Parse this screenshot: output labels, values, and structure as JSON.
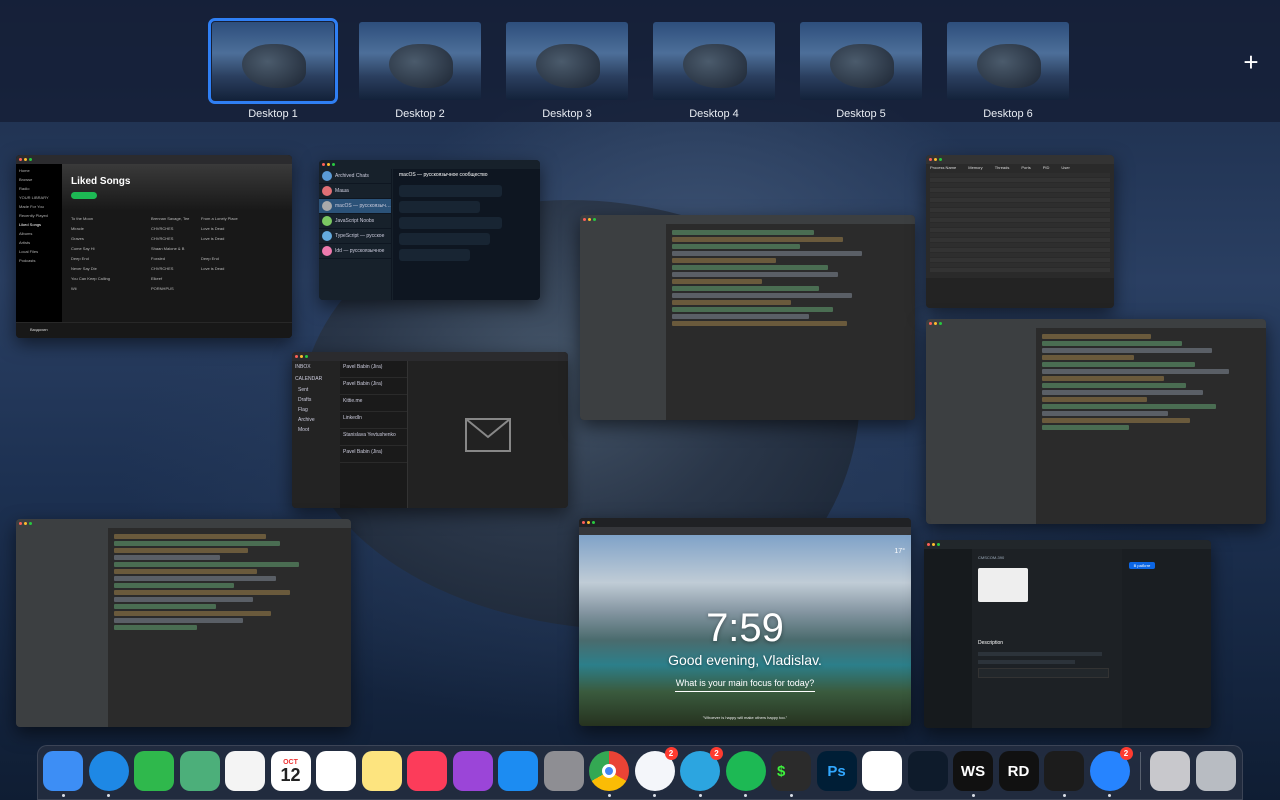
{
  "spaces": {
    "desktops": [
      {
        "label": "Desktop 1",
        "active": true
      },
      {
        "label": "Desktop 2",
        "active": false
      },
      {
        "label": "Desktop 3",
        "active": false
      },
      {
        "label": "Desktop 4",
        "active": false
      },
      {
        "label": "Desktop 5",
        "active": false
      },
      {
        "label": "Desktop 6",
        "active": false
      }
    ],
    "add_label": "+"
  },
  "windows": {
    "spotify": {
      "title": "Liked Songs",
      "sidebar": [
        "Home",
        "Browse",
        "Radio",
        "YOUR LIBRARY",
        "Made For You",
        "Recently Played",
        "Liked Songs",
        "Albums",
        "Artists",
        "Local Files",
        "Podcasts"
      ],
      "tracks": [
        {
          "title": "To the Moon",
          "artist": "Brennan Savage, Tee",
          "album": "From a Lonely Place"
        },
        {
          "title": "Miracle",
          "artist": "CHVRCHES",
          "album": "Love is Dead"
        },
        {
          "title": "Graves",
          "artist": "CHVRCHES",
          "album": "Love is Dead"
        },
        {
          "title": "Come Say Hi",
          "artist": "Shaan Malone & B",
          "album": ""
        },
        {
          "title": "Deep End",
          "artist": "Foxsled",
          "album": "Deep End"
        },
        {
          "title": "Never Say Die",
          "artist": "CHVRCHES",
          "album": "Love is Dead"
        },
        {
          "title": "You Can Keep Calling",
          "artist": "Elkeef",
          "album": ""
        },
        {
          "title": "Wii",
          "artist": "PORNHPUS",
          "album": ""
        }
      ],
      "user": "Ваздохин"
    },
    "telegram": {
      "chats": [
        "Archived Chats",
        "Маша",
        "macOS — русскоязыч…",
        "JavaScript Noobs",
        "TypeScript — русское",
        "Idd — русскоязычное"
      ],
      "header": "macOS — русскоязычное сообщество"
    },
    "mail": {
      "accounts": [
        "INBOX",
        "CALENDAR"
      ],
      "folders": [
        "Sent",
        "Drafts",
        "Flag",
        "Archive",
        "Moot"
      ],
      "messages": [
        "Pavel Babin (Jira)",
        "Pavel Babin (Jira)",
        "Kittie.me",
        "LinkedIn",
        "Stanislava Yevtushenko",
        "Pavel Babin (Jira)"
      ]
    },
    "activity_monitor": {
      "columns": [
        "Process Name",
        "Memory",
        "Threads",
        "Ports",
        "PID",
        "User"
      ]
    },
    "momentum": {
      "time": "7:59",
      "greeting": "Good evening, Vladislav.",
      "focus_prompt": "What is your main focus for today?",
      "quote": "\"Whoever is happy will make others happy too.\"",
      "temperature": "17°"
    },
    "jira": {
      "ticket": "CMSCOM-390",
      "status_button": "В работе",
      "section": "Description"
    }
  },
  "dock": {
    "apps": [
      {
        "name": "Finder",
        "icon": "finder-icon",
        "color": "#3d8ef5",
        "running": true
      },
      {
        "name": "Safari",
        "icon": "safari-icon",
        "color": "#1e88e5",
        "running": true
      },
      {
        "name": "FaceTime",
        "icon": "facetime-icon",
        "color": "#2fb84c",
        "running": false
      },
      {
        "name": "Maps",
        "icon": "maps-icon",
        "color": "#4caf7a",
        "running": false
      },
      {
        "name": "Photos",
        "icon": "photos-icon",
        "color": "#f4f4f4",
        "running": false
      },
      {
        "name": "Calendar",
        "icon": "calendar-icon",
        "color": "#ffffff",
        "running": false,
        "label": "12",
        "month": "OCT"
      },
      {
        "name": "Reminders",
        "icon": "reminders-icon",
        "color": "#ffffff",
        "running": false
      },
      {
        "name": "Notes",
        "icon": "notes-icon",
        "color": "#fde47f",
        "running": false
      },
      {
        "name": "Music",
        "icon": "music-icon",
        "color": "#fc3c5a",
        "running": false
      },
      {
        "name": "Podcasts",
        "icon": "podcasts-icon",
        "color": "#9b45d8",
        "running": false
      },
      {
        "name": "App Store",
        "icon": "appstore-icon",
        "color": "#1c8cf2",
        "running": false
      },
      {
        "name": "System Preferences",
        "icon": "settings-icon",
        "color": "#8e8e93",
        "running": false
      },
      {
        "name": "Chrome",
        "icon": "chrome-icon",
        "color": "#ffffff",
        "running": true
      },
      {
        "name": "Spark",
        "icon": "spark-icon",
        "color": "#f4f6fa",
        "running": true,
        "badge": "2"
      },
      {
        "name": "Telegram",
        "icon": "telegram-icon",
        "color": "#2ca5e0",
        "running": true,
        "badge": "2"
      },
      {
        "name": "Spotify",
        "icon": "spotify-icon",
        "color": "#1db954",
        "running": true
      },
      {
        "name": "Terminal",
        "icon": "terminal-icon",
        "color": "#2b2b2b",
        "running": true,
        "label": "$"
      },
      {
        "name": "Photoshop",
        "icon": "photoshop-icon",
        "color": "#001e36",
        "running": false,
        "label": "Ps"
      },
      {
        "name": "Numbers",
        "icon": "numbers-icon",
        "color": "#ffffff",
        "running": false
      },
      {
        "name": "VS Code",
        "icon": "vscode-icon",
        "color": "#0e1b2b",
        "running": false
      },
      {
        "name": "WebStorm",
        "icon": "webstorm-icon",
        "color": "#111111",
        "running": true,
        "label": "WS"
      },
      {
        "name": "Rider",
        "icon": "rider-icon",
        "color": "#111111",
        "running": false,
        "label": "RD"
      },
      {
        "name": "Activity Monitor",
        "icon": "activity-icon",
        "color": "#1c1c1c",
        "running": true
      },
      {
        "name": "Jira",
        "icon": "jira-icon",
        "color": "#2684ff",
        "running": true,
        "badge": "2"
      },
      {
        "name": "Disk Utility",
        "icon": "drive-icon",
        "color": "#c8c8cc",
        "running": false
      },
      {
        "name": "Trash",
        "icon": "trash-icon",
        "color": "#b8bcc2",
        "running": false
      }
    ]
  }
}
